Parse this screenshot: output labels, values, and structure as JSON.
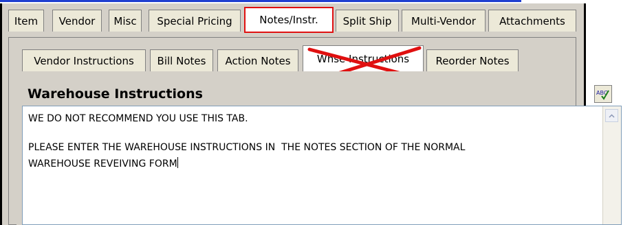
{
  "tabs": [
    {
      "label": "Item"
    },
    {
      "label": "Vendor"
    },
    {
      "label": "Misc"
    },
    {
      "label": "Special Pricing"
    },
    {
      "label": "Notes/Instr."
    },
    {
      "label": "Split Ship"
    },
    {
      "label": "Multi-Vendor"
    },
    {
      "label": "Attachments"
    }
  ],
  "subtabs": [
    {
      "label": "Vendor Instructions"
    },
    {
      "label": "Bill Notes"
    },
    {
      "label": "Action Notes"
    },
    {
      "label": "Whse Instructions"
    },
    {
      "label": "Reorder Notes"
    }
  ],
  "section": {
    "title": "Warehouse Instructions"
  },
  "spell_icon_text": "ABC",
  "text": {
    "line1": "WE DO NOT RECOMMEND YOU USE THIS TAB.",
    "line2": "PLEASE ENTER THE WAREHOUSE INSTRUCTIONS IN  THE NOTES SECTION OF THE NORMAL",
    "line3": "WAREHOUSE REVEIVING FORM"
  },
  "colors": {
    "highlight": "#e01010",
    "accent": "#1f3fd0"
  }
}
